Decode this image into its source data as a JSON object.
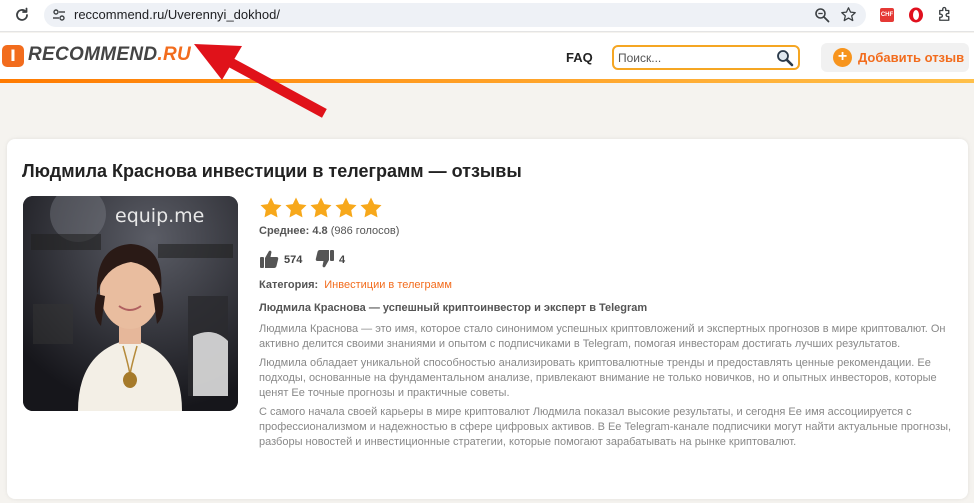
{
  "browser": {
    "url": "reccommend.ru/Uverennyi_dokhod/",
    "ext_badge": "CHF"
  },
  "header": {
    "logo_badge": "I",
    "logo_main": "RECOMMEND",
    "logo_suffix": ".RU",
    "faq_label": "FAQ",
    "search_placeholder": "Поиск...",
    "add_review_plus": "+",
    "add_review_label": "Добавить отзыв",
    "accent_color": "#f26c1d"
  },
  "page": {
    "title": "Людмила Краснова инвестиции в телеграмм — отзывы",
    "photo_watermark": "equip.me",
    "rating": {
      "stars": 5,
      "stars_max": 5,
      "average_label": "Среднее:",
      "average_value": "4.8",
      "votes_text": "(986 голосов)"
    },
    "likes": "574",
    "dislikes": "4",
    "category_label": "Категория:",
    "category_value": "Инвестиции в телеграмм",
    "description": {
      "heading": "Людмила Краснова — успешный криптоинвестор и эксперт в Telegram",
      "p1": "Людмила Краснова — это имя, которое стало синонимом успешных криптовложений и экспертных прогнозов в мире криптовалют. Он активно делится своими знаниями и опытом с подписчиками в Telegram, помогая инвесторам достигать лучших результатов.",
      "p2": "Людмила обладает уникальной способностью анализировать криптовалютные тренды и предоставлять ценные рекомендации. Ее подходы, основанные на фундаментальном анализе, привлекают внимание не только новичков, но и опытных инвесторов, которые ценят Ее точные прогнозы и практичные советы.",
      "p3": "С самого начала своей карьеры в мире криптовалют Людмила показал высокие результаты, и сегодня Ее имя ассоциируется с профессионализмом и надежностью в сфере цифровых активов. В Ее Telegram-канале подписчики могут найти актуальные прогнозы, разборы новостей и инвестиционные стратегии, которые помогают зарабатывать на рынке криптовалют."
    }
  }
}
